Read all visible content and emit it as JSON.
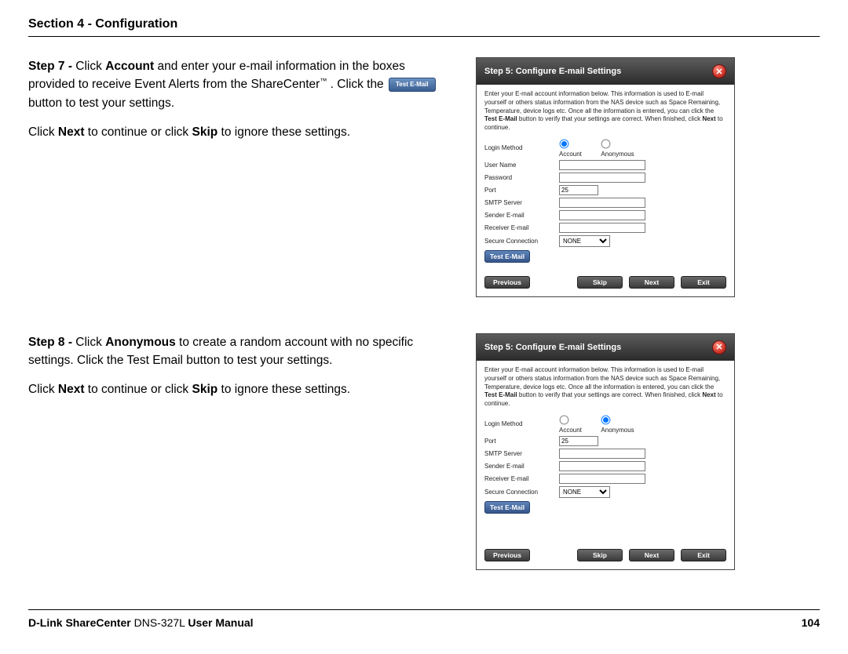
{
  "header": "Section 4 - Configuration",
  "step7": {
    "lead": "Step 7 -",
    "t1_a": "Click ",
    "t1_b": "Account",
    "t1_c": " and enter your e-mail information in the boxes provided to receive Event Alerts from the ShareCenter",
    "tm": "™",
    "t1_d": " . Click the ",
    "inline_btn": "Test E-Mail",
    "t1_e": " button to test your settings.",
    "t2_a": "Click ",
    "t2_b": "Next",
    "t2_c": " to continue or click ",
    "t2_d": "Skip",
    "t2_e": " to ignore these settings."
  },
  "step8": {
    "lead": "Step 8 -",
    "t1_a": "Click ",
    "t1_b": "Anonymous",
    "t1_c": " to create a random account with no specific settings. Click the Test Email button to test your settings.",
    "t2_a": "Click ",
    "t2_b": "Next",
    "t2_c": " to continue or click ",
    "t2_d": "Skip",
    "t2_e": " to ignore these settings."
  },
  "dlg": {
    "title": "Step 5: Configure E-mail Settings",
    "desc_a": "Enter your E-mail account information below. This information is used to E-mail yourself or others status information from the NAS device such as Space Remaining, Temperature, device logs etc. Once all the information is entered, you can click the ",
    "desc_bold": "Test E-Mail",
    "desc_b": " button to verify that your settings are correct. When finished, click ",
    "desc_bold2": "Next",
    "desc_c": " to continue.",
    "labels": {
      "login_method": "Login Method",
      "user_name": "User Name",
      "password": "Password",
      "port": "Port",
      "smtp": "SMTP Server",
      "sender": "Sender E-mail",
      "receiver": "Receiver E-mail",
      "secure": "Secure Connection"
    },
    "radio_account": "Account",
    "radio_anon": "Anonymous",
    "port_val": "25",
    "secure_opt": "NONE",
    "btn_test": "Test E-Mail",
    "btn_prev": "Previous",
    "btn_skip": "Skip",
    "btn_next": "Next",
    "btn_exit": "Exit"
  },
  "footer": {
    "brand": "D-Link ShareCenter",
    "model": " DNS-327L ",
    "suffix": "User Manual",
    "page": "104"
  }
}
